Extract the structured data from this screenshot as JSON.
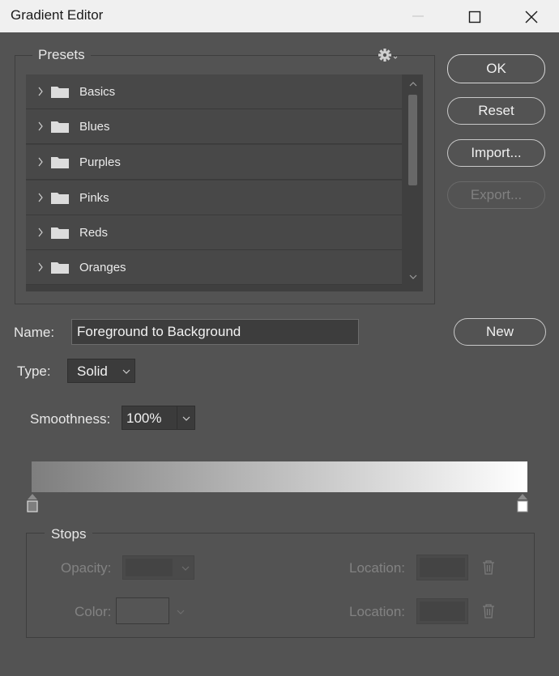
{
  "window": {
    "title": "Gradient Editor"
  },
  "presets": {
    "label": "Presets",
    "items": [
      {
        "label": "Basics"
      },
      {
        "label": "Blues"
      },
      {
        "label": "Purples"
      },
      {
        "label": "Pinks"
      },
      {
        "label": "Reds"
      },
      {
        "label": "Oranges"
      }
    ]
  },
  "buttons": {
    "ok": "OK",
    "reset": "Reset",
    "import": "Import...",
    "export": "Export...",
    "new": "New"
  },
  "name": {
    "label": "Name:",
    "value": "Foreground to Background"
  },
  "type": {
    "label": "Type:",
    "value": "Solid"
  },
  "smoothness": {
    "label": "Smoothness:",
    "value": "100%"
  },
  "gradient": {
    "start_color": "#7e7e7e",
    "end_color": "#ffffff"
  },
  "stops": {
    "label": "Stops",
    "opacity_label": "Opacity:",
    "color_label": "Color:",
    "location_label": "Location:",
    "location2_label": "Location:"
  }
}
